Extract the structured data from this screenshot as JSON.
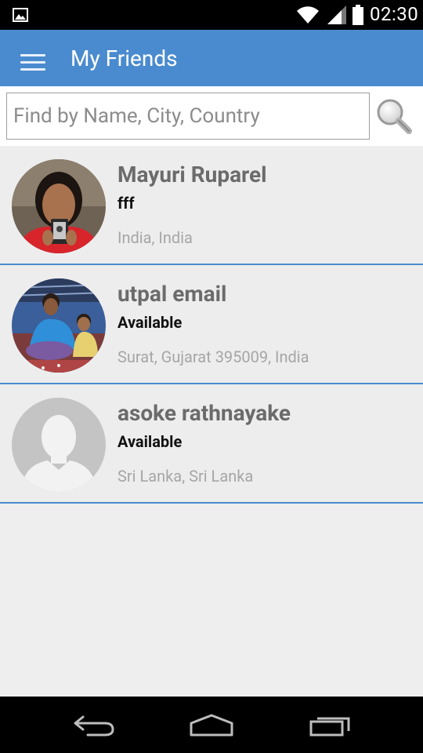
{
  "status_bar": {
    "time": "02:30",
    "icons": [
      "gallery-icon",
      "wifi-icon",
      "signal-icon",
      "battery-icon"
    ]
  },
  "app_bar": {
    "title": "My Friends",
    "menu_icon": "hamburger-menu-icon",
    "color": "#4a8bcf"
  },
  "search": {
    "placeholder": "Find by Name, City, Country",
    "value": "",
    "button_icon": "magnifier-search-icon"
  },
  "friends": [
    {
      "name": "Mayuri Ruparel",
      "status": "fff",
      "location": "India, India",
      "avatar": "photo"
    },
    {
      "name": "utpal email",
      "status": "Available",
      "location": "Surat, Gujarat 395009, India",
      "avatar": "photo"
    },
    {
      "name": "asoke rathnayake",
      "status": "Available",
      "location": "Sri Lanka, Sri Lanka",
      "avatar": "default-person"
    }
  ],
  "nav_bar": {
    "icons": [
      "back-icon",
      "home-icon",
      "recent-apps-icon"
    ]
  }
}
